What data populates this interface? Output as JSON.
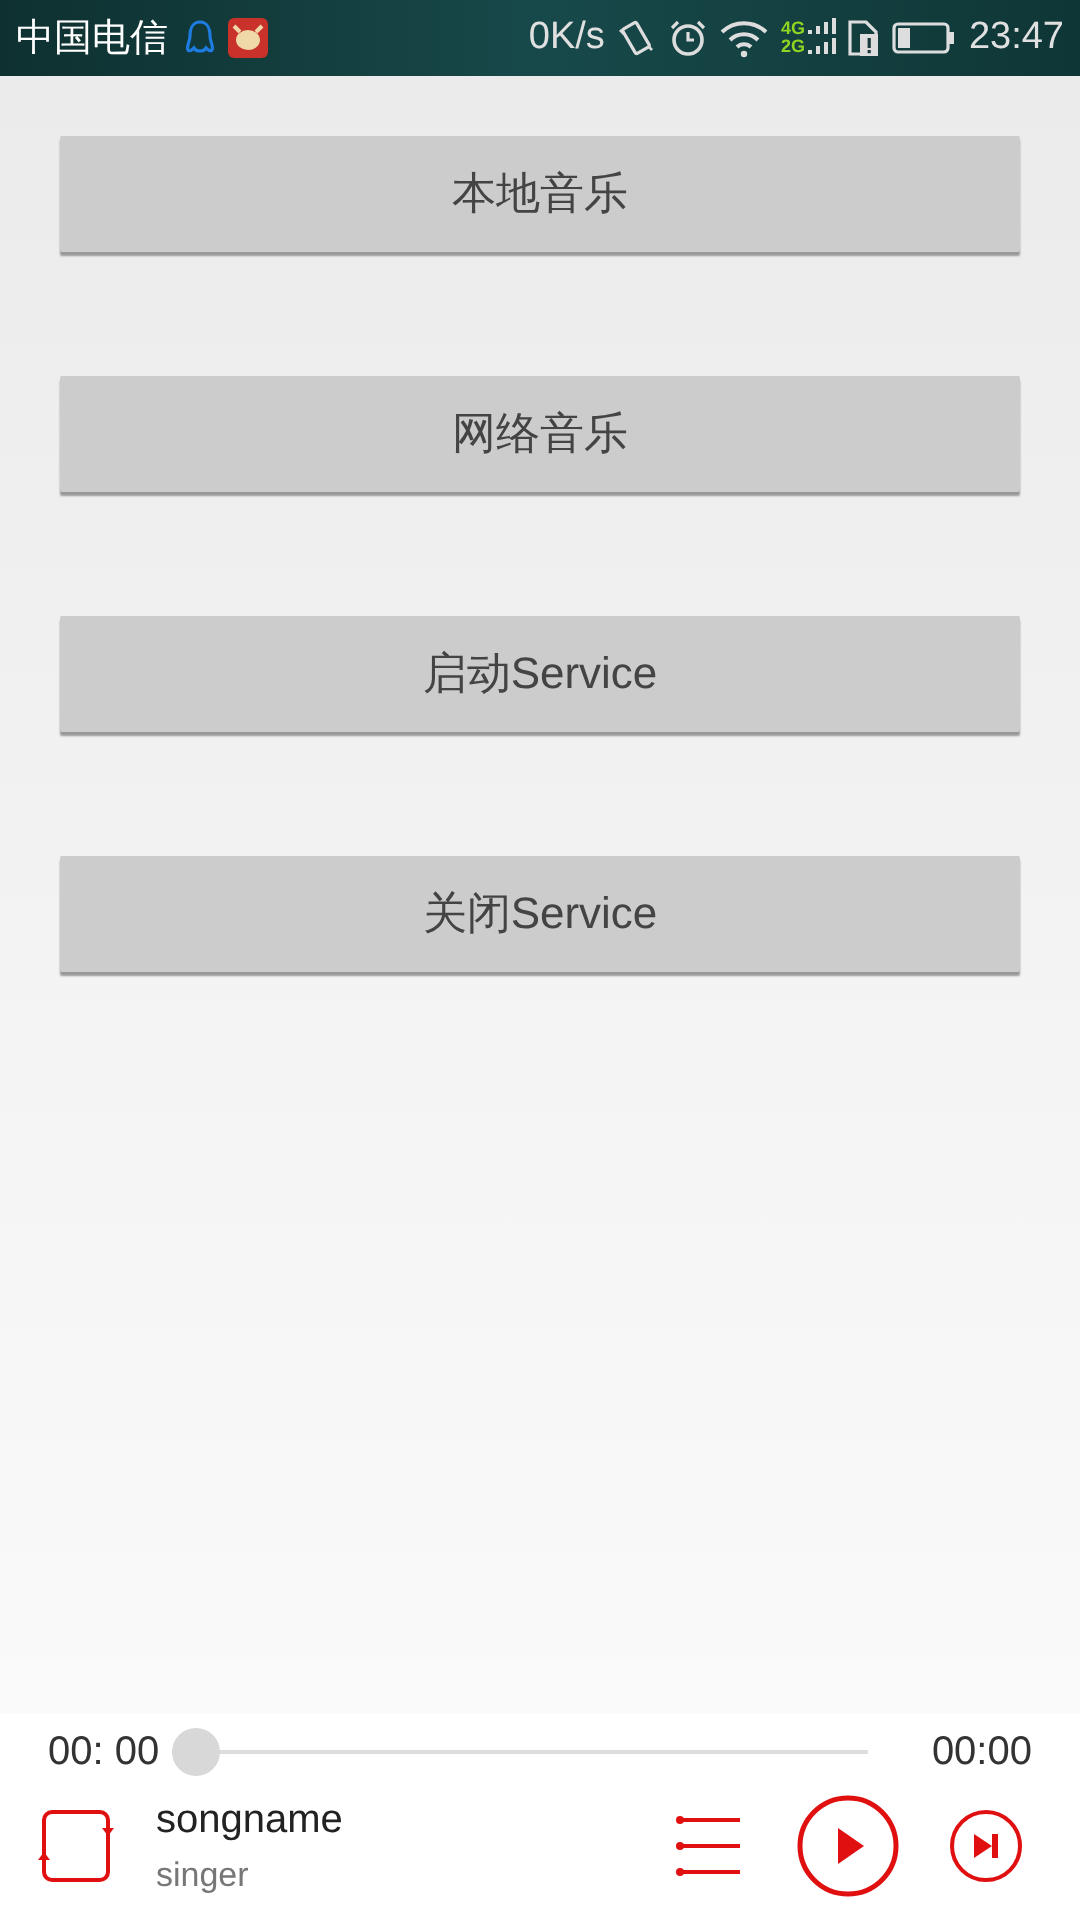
{
  "status_bar": {
    "carrier": "中国电信",
    "speed": "0K/s",
    "network_labels": [
      "4G",
      "2G"
    ],
    "time": "23:47"
  },
  "buttons": [
    "本地音乐",
    "网络音乐",
    "启动Service",
    "关闭Service"
  ],
  "player": {
    "elapsed": "00:  00",
    "duration": "00:00",
    "level": 0,
    "song": "songname",
    "singer": "singer"
  }
}
